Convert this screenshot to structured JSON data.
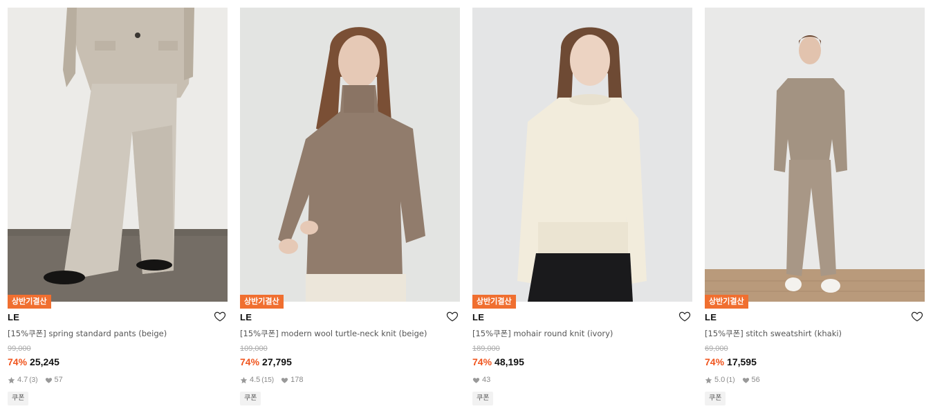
{
  "products": [
    {
      "badge": "상반기결산",
      "brand": "LE",
      "name": "[15%쿠폰] spring standard pants (beige)",
      "original_price": "99,000",
      "discount": "74%",
      "price": "25,245",
      "rating": "4.7",
      "review_count": "(3)",
      "likes": "57",
      "tag": "쿠폰",
      "image": "model-beige-suit-pants"
    },
    {
      "badge": "상반기결산",
      "brand": "LE",
      "name": "[15%쿠폰] modern wool turtle-neck knit (beige)",
      "original_price": "109,000",
      "discount": "74%",
      "price": "27,795",
      "rating": "4.5",
      "review_count": "(15)",
      "likes": "178",
      "tag": "쿠폰",
      "image": "model-beige-turtleneck"
    },
    {
      "badge": "상반기결산",
      "brand": "LE",
      "name": "[15%쿠폰] mohair round knit (ivory)",
      "original_price": "189,000",
      "discount": "74%",
      "price": "48,195",
      "rating": "",
      "review_count": "",
      "likes": "43",
      "tag": "쿠폰",
      "image": "model-ivory-mohair-knit"
    },
    {
      "badge": "상반기결산",
      "brand": "LE",
      "name": "[15%쿠폰] stitch sweatshirt (khaki)",
      "original_price": "69,000",
      "discount": "74%",
      "price": "17,595",
      "rating": "5.0",
      "review_count": "(1)",
      "likes": "56",
      "tag": "쿠폰",
      "image": "model-khaki-sweatshirt"
    }
  ],
  "colors": {
    "badge_bg": "#f06f30",
    "discount": "#f0551e",
    "muted": "#888888"
  },
  "icons": {
    "wishlist": "heart-outline-icon",
    "rating": "star-icon",
    "likes": "heart-filled-icon"
  }
}
